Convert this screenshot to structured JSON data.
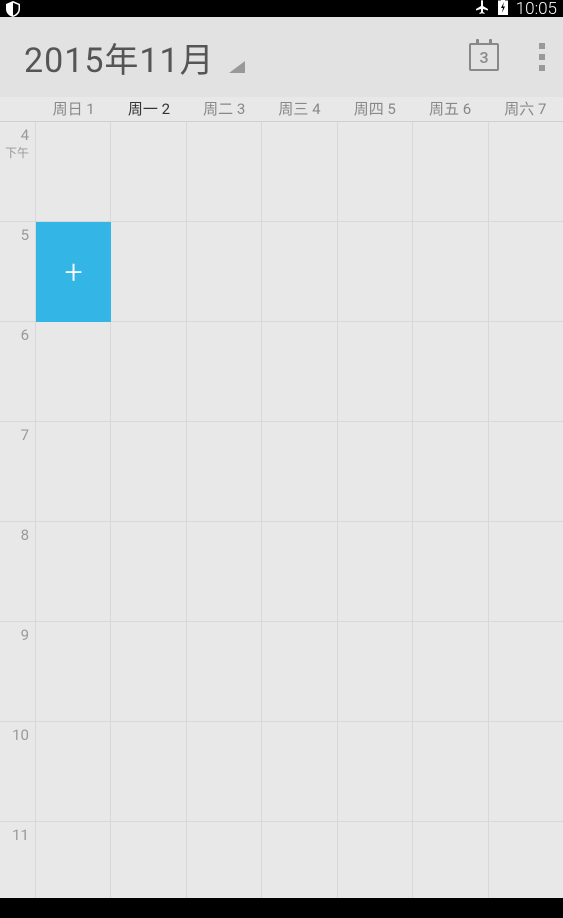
{
  "status": {
    "time": "10:05"
  },
  "header": {
    "month_title": "2015年11月",
    "today_number": "3"
  },
  "days": [
    {
      "label": "周日 1",
      "current": false
    },
    {
      "label": "周一 2",
      "current": true
    },
    {
      "label": "周二 3",
      "current": false
    },
    {
      "label": "周三 4",
      "current": false
    },
    {
      "label": "周四 5",
      "current": false
    },
    {
      "label": "周五 6",
      "current": false
    },
    {
      "label": "周六 7",
      "current": false
    }
  ],
  "hours": [
    {
      "label": "4",
      "sub": "下午"
    },
    {
      "label": "5",
      "sub": ""
    },
    {
      "label": "6",
      "sub": ""
    },
    {
      "label": "7",
      "sub": ""
    },
    {
      "label": "8",
      "sub": ""
    },
    {
      "label": "9",
      "sub": ""
    },
    {
      "label": "10",
      "sub": ""
    },
    {
      "label": "11",
      "sub": ""
    }
  ],
  "new_event": {
    "symbol": "+",
    "hour_index": 1,
    "day_index": 0,
    "color": "#33b5e5"
  }
}
